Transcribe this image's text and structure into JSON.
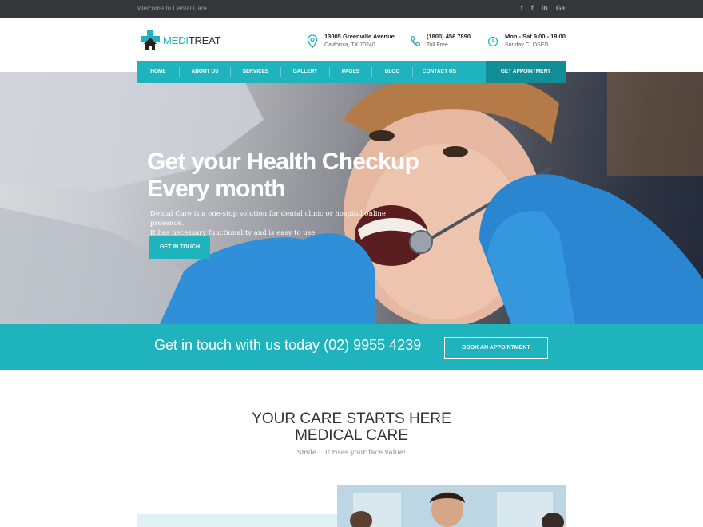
{
  "topbar": {
    "welcome": "Welcome to Dental Care",
    "social": [
      {
        "icon": "twitter-icon",
        "glyph": "t"
      },
      {
        "icon": "facebook-icon",
        "glyph": "f"
      },
      {
        "icon": "linkedin-icon",
        "glyph": "in"
      },
      {
        "icon": "google-plus-icon",
        "glyph": "G+"
      }
    ]
  },
  "logo": {
    "part1": "MEDI",
    "part2": "TREAT"
  },
  "header": {
    "address": {
      "line1": "13005 Greenville Avenue",
      "line2": "California, TX 70240"
    },
    "phone": {
      "line1": "(1800) 456 7890",
      "line2": "Toll Free"
    },
    "hours": {
      "line1": "Mon - Sat 9.00 - 19.00",
      "line2": "Sunday CLOSED"
    }
  },
  "nav": {
    "items": [
      "HOME",
      "ABOUT US",
      "SERVICES",
      "GALLERY",
      "PAGES",
      "BLOG",
      "CONTACT US"
    ],
    "cta": "GET APPOINTMENT"
  },
  "hero": {
    "title_line1": "Get your Health Checkup",
    "title_line2": "Every month",
    "desc_line1": "Dental Care is a one-stop solution for dental clinic or hospital online presence.",
    "desc_line2": "It has necessary functionality and is easy to use",
    "button": "GET IN TOUCH"
  },
  "band": {
    "text": "Get in touch with us today (02) 9955 4239",
    "button": "BOOK AN APPOINTMENT"
  },
  "section": {
    "title_line1": "YOUR CARE STARTS HERE",
    "title_line2": "MEDICAL CARE",
    "subtitle": "Smile... it rises your face value!"
  },
  "colors": {
    "accent": "#1fb4bd",
    "accent_dark": "#128f96",
    "topbar": "#353638"
  }
}
